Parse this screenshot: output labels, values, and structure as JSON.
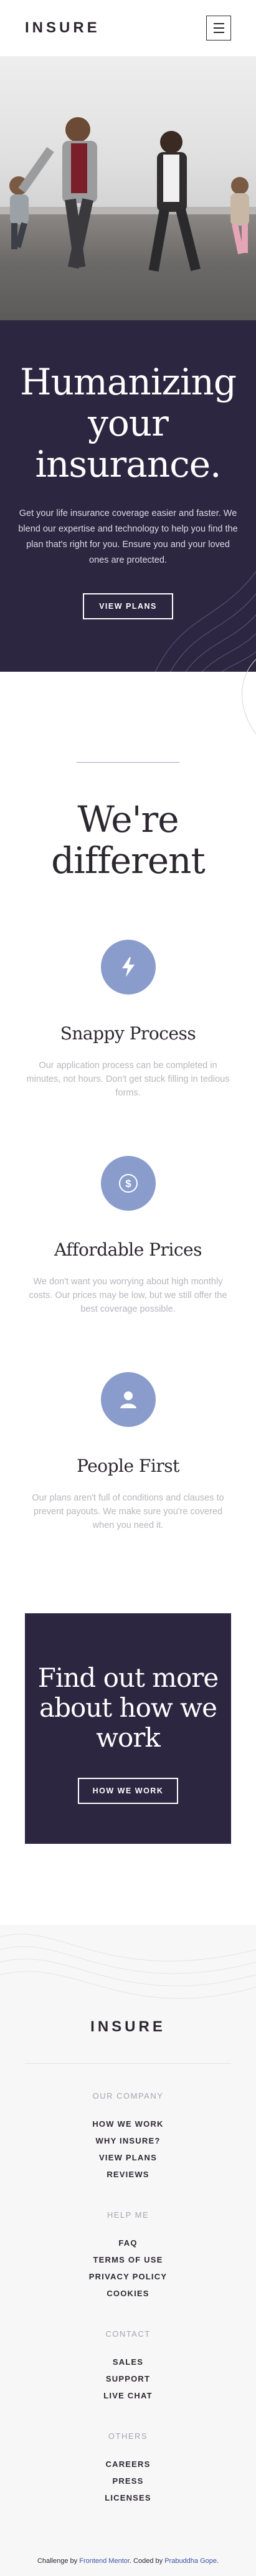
{
  "header": {
    "logo": "INSURE",
    "menu_icon": "hamburger-icon"
  },
  "hero": {
    "title": "Humanizing your insurance.",
    "text": "Get your life insurance coverage easier and faster. We blend our expertise and technology to help you find the plan that's right for you. Ensure you and your loved ones are protected.",
    "button": "VIEW PLANS"
  },
  "different": {
    "title": "We're different",
    "features": [
      {
        "icon": "lightning-icon",
        "title": "Snappy Process",
        "text": "Our application process can be completed in minutes, not hours. Don't get stuck filling in tedious forms."
      },
      {
        "icon": "dollar-icon",
        "title": "Affordable Prices",
        "text": "We don't want you worrying about high monthly costs. Our prices may be low, but we still offer the best coverage possible."
      },
      {
        "icon": "person-icon",
        "title": "People First",
        "text": "Our plans aren't full of conditions and clauses to prevent payouts. We make sure you're covered when you need it."
      }
    ]
  },
  "cta": {
    "title": "Find out more about how we work",
    "button": "HOW WE WORK"
  },
  "footer": {
    "logo": "INSURE",
    "columns": [
      {
        "heading": "OUR COMPANY",
        "links": [
          "HOW WE WORK",
          "WHY INSURE?",
          "VIEW PLANS",
          "REVIEWS"
        ]
      },
      {
        "heading": "HELP ME",
        "links": [
          "FAQ",
          "TERMS OF USE",
          "PRIVACY POLICY",
          "COOKIES"
        ]
      },
      {
        "heading": "CONTACT",
        "links": [
          "SALES",
          "SUPPORT",
          "LIVE CHAT"
        ]
      },
      {
        "heading": "OTHERS",
        "links": [
          "CAREERS",
          "PRESS",
          "LICENSES"
        ]
      }
    ],
    "attribution": {
      "prefix": "Challenge by",
      "challenge_link": "Frontend Mentor",
      "middle": ". Coded by",
      "author_link": "Prabuddha Gope",
      "suffix": "."
    }
  },
  "colors": {
    "dark_violet": "#2c2640",
    "accent_blue": "#8a9ccb",
    "text_gray": "#b8b6bc",
    "link_blue": "#3e52a3"
  }
}
